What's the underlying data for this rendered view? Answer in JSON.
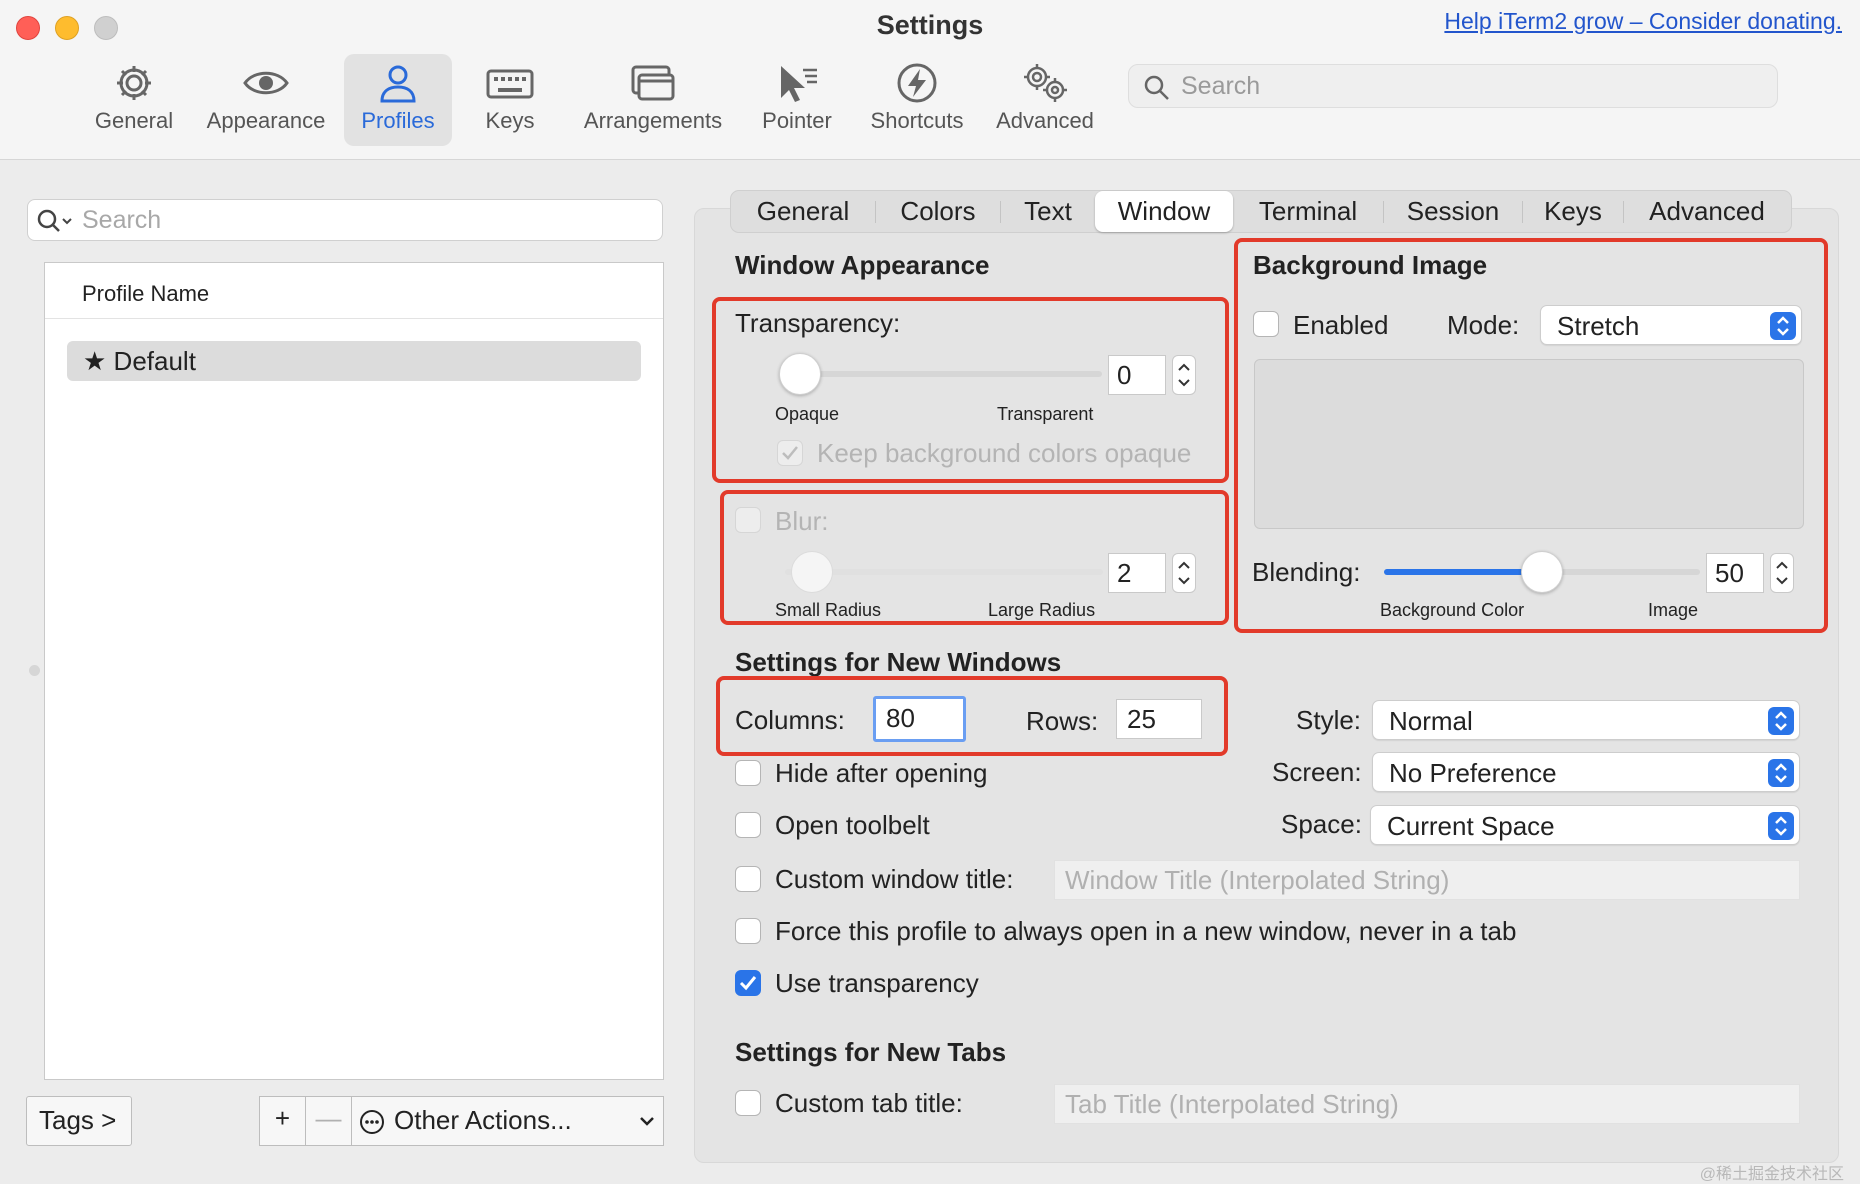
{
  "window": {
    "title": "Settings",
    "donate_link": "Help iTerm2 grow – Consider donating."
  },
  "toolbar": {
    "items": [
      {
        "label": "General",
        "icon": "gear-icon"
      },
      {
        "label": "Appearance",
        "icon": "eye-icon"
      },
      {
        "label": "Profiles",
        "icon": "person-icon",
        "active": true
      },
      {
        "label": "Keys",
        "icon": "keyboard-icon"
      },
      {
        "label": "Arrangements",
        "icon": "windows-icon"
      },
      {
        "label": "Pointer",
        "icon": "pointer-icon"
      },
      {
        "label": "Shortcuts",
        "icon": "bolt-icon"
      },
      {
        "label": "Advanced",
        "icon": "gears-icon"
      }
    ],
    "search_placeholder": "Search"
  },
  "profiles": {
    "search_placeholder": "Search",
    "column_header": "Profile Name",
    "items": [
      {
        "name": "Default",
        "is_default": true
      }
    ],
    "tags_button": "Tags >",
    "add_button": "+",
    "remove_button": "—",
    "other_actions": "Other Actions..."
  },
  "tabs": [
    {
      "label": "General"
    },
    {
      "label": "Colors"
    },
    {
      "label": "Text"
    },
    {
      "label": "Window",
      "active": true
    },
    {
      "label": "Terminal"
    },
    {
      "label": "Session"
    },
    {
      "label": "Keys"
    },
    {
      "label": "Advanced"
    }
  ],
  "window_appearance": {
    "title": "Window Appearance",
    "transparency": {
      "label": "Transparency:",
      "value": "0",
      "level": 0.0,
      "min_label": "Opaque",
      "max_label": "Transparent",
      "keep_bg_opaque": {
        "label": "Keep background colors opaque",
        "checked": true,
        "disabled": true
      }
    },
    "blur": {
      "label": "Blur:",
      "enabled": false,
      "value": "2",
      "level": 0.02,
      "min_label": "Small Radius",
      "max_label": "Large Radius"
    }
  },
  "background_image": {
    "title": "Background Image",
    "enabled_label": "Enabled",
    "enabled": false,
    "mode_label": "Mode:",
    "mode_value": "Stretch",
    "blending_label": "Blending:",
    "blending_value": "50",
    "blending_level": 0.5,
    "blend_min_label": "Background Color",
    "blend_max_label": "Image"
  },
  "new_windows": {
    "title": "Settings for New Windows",
    "columns_label": "Columns:",
    "columns_value": "80",
    "rows_label": "Rows:",
    "rows_value": "25",
    "style_label": "Style:",
    "style_value": "Normal",
    "screen_label": "Screen:",
    "screen_value": "No Preference",
    "space_label": "Space:",
    "space_value": "Current Space",
    "hide_after_opening": {
      "label": "Hide after opening",
      "checked": false
    },
    "open_toolbelt": {
      "label": "Open toolbelt",
      "checked": false
    },
    "custom_window_title": {
      "label": "Custom window title:",
      "checked": false,
      "placeholder": "Window Title (Interpolated String)"
    },
    "force_new_window": {
      "label": "Force this profile to always open in a new window, never in a tab",
      "checked": false
    },
    "use_transparency": {
      "label": "Use transparency",
      "checked": true
    }
  },
  "new_tabs": {
    "title": "Settings for New Tabs",
    "custom_tab_title": {
      "label": "Custom tab title:",
      "checked": false,
      "placeholder": "Tab Title (Interpolated String)"
    }
  },
  "watermark": "@稀土掘金技术社区",
  "colors": {
    "accent": "#2a74e8",
    "highlight_box": "#e23a2a",
    "link": "#2255cc"
  }
}
